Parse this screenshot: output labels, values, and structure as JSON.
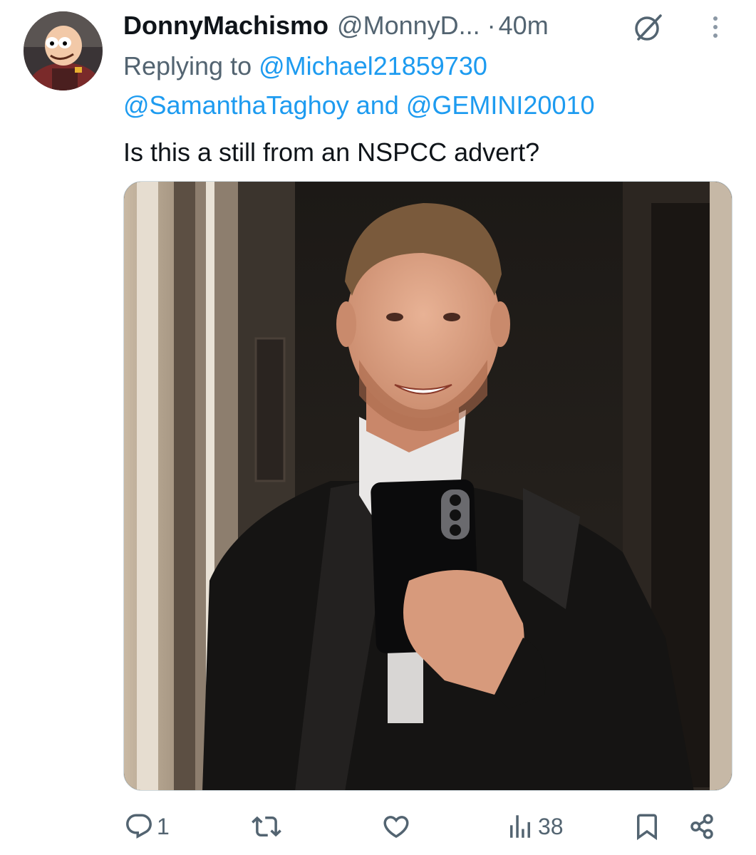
{
  "tweet": {
    "display_name": "DonnyMachismo",
    "handle": "@MonnyD...",
    "separator": "·",
    "time": "40m",
    "replying_prefix": "Replying to",
    "mention_1": "@Michael21859730",
    "mention_2": "@SamanthaTaghoy",
    "and_word": "and",
    "mention_3": "@GEMINI20010",
    "text": "Is this a still from an NSPCC advert?"
  },
  "actions": {
    "replies": "1",
    "retweets": "",
    "likes": "",
    "views": "38"
  },
  "icons": {
    "avatar": "cartoon-avatar",
    "grok": "grok-icon",
    "more": "more-vertical-icon",
    "reply": "reply-icon",
    "retweet": "retweet-icon",
    "like": "heart-icon",
    "views": "views-icon",
    "bookmark": "bookmark-icon",
    "share": "share-icon"
  },
  "colors": {
    "link": "#1d9bf0",
    "secondary_text": "#536471",
    "primary_text": "#0f1419"
  }
}
